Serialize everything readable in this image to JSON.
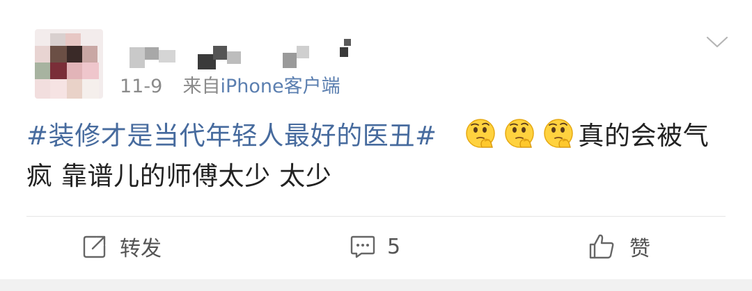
{
  "post": {
    "meta": {
      "date": "11-9",
      "source_prefix": "来自",
      "source_name": "iPhone客户端"
    },
    "topic": "#装修才是当代年轻人最好的医丑#",
    "text_after_emoji": "真的会被气疯 靠谱儿的师傅太少 太少",
    "emoji_icon": "thinking-face-emoji",
    "colors": {
      "topic": "#476b9e",
      "source": "#5b7fb0",
      "meta": "#8a8a8a"
    }
  },
  "actions": {
    "repost_label": "转发",
    "comment_count": "5",
    "like_label": "赞"
  }
}
